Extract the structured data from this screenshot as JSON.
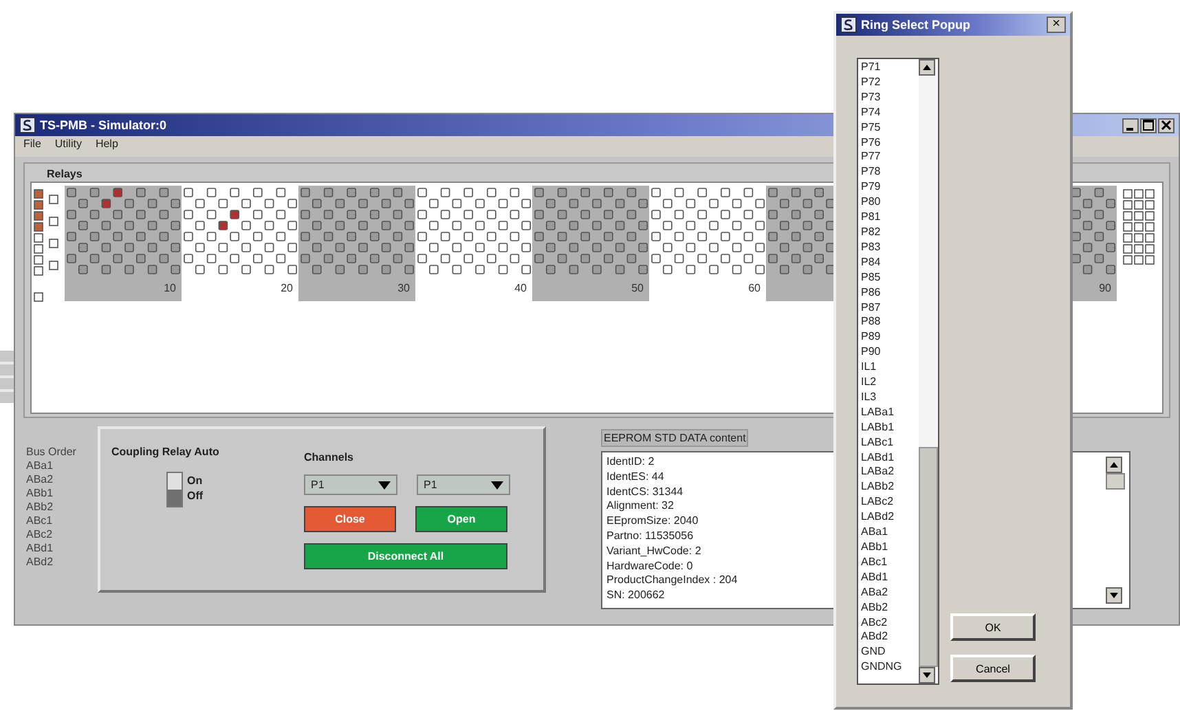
{
  "main_window": {
    "title": "TS-PMB - Simulator:0",
    "menu": [
      "File",
      "Utility",
      "Help"
    ]
  },
  "relays": {
    "title": "Relays",
    "indicators": [
      {
        "on": true
      },
      {
        "on": true
      },
      {
        "on": true
      },
      {
        "on": true
      },
      {
        "on": false
      },
      {
        "on": false
      },
      {
        "on": false
      },
      {
        "on": false
      }
    ],
    "left_blocks": [
      {
        "label": "10",
        "shaded": true,
        "rows": [
          [
            false,
            false,
            true,
            false,
            false
          ],
          [
            false,
            true,
            false,
            false,
            false
          ],
          [
            false,
            false,
            false,
            false,
            false
          ],
          [
            false,
            false,
            false,
            false,
            false
          ],
          [
            false,
            false,
            false,
            false,
            false
          ],
          [
            false,
            false,
            false,
            false,
            false
          ],
          [
            false,
            false,
            false,
            false,
            false
          ],
          [
            false,
            false,
            false,
            false,
            false
          ]
        ]
      },
      {
        "label": "20",
        "shaded": false,
        "rows": [
          [
            false,
            false,
            false,
            false,
            false
          ],
          [
            false,
            false,
            false,
            false,
            false
          ],
          [
            false,
            false,
            true,
            false,
            false
          ],
          [
            false,
            true,
            false,
            false,
            false
          ],
          [
            false,
            false,
            false,
            false,
            false
          ],
          [
            false,
            false,
            false,
            false,
            false
          ],
          [
            false,
            false,
            false,
            false,
            false
          ],
          [
            false,
            false,
            false,
            false,
            false
          ]
        ]
      },
      {
        "label": "30",
        "shaded": true,
        "rows": [
          [
            false,
            false,
            false,
            false,
            false
          ],
          [
            false,
            false,
            false,
            false,
            false
          ],
          [
            false,
            false,
            false,
            false,
            false
          ],
          [
            false,
            false,
            false,
            false,
            false
          ],
          [
            false,
            false,
            false,
            false,
            false
          ],
          [
            false,
            false,
            false,
            false,
            false
          ],
          [
            false,
            false,
            false,
            false,
            false
          ],
          [
            false,
            false,
            false,
            false,
            false
          ]
        ]
      },
      {
        "label": "40",
        "shaded": false,
        "rows": [
          [
            false,
            false,
            false,
            false,
            false
          ],
          [
            false,
            false,
            false,
            false,
            false
          ],
          [
            false,
            false,
            false,
            false,
            false
          ],
          [
            false,
            false,
            false,
            false,
            false
          ],
          [
            false,
            false,
            false,
            false,
            false
          ],
          [
            false,
            false,
            false,
            false,
            false
          ],
          [
            false,
            false,
            false,
            false,
            false
          ],
          [
            false,
            false,
            false,
            false,
            false
          ]
        ]
      },
      {
        "label": "50",
        "shaded": true,
        "rows": [
          [
            false,
            false,
            false,
            false,
            false
          ],
          [
            false,
            false,
            false,
            false,
            false
          ],
          [
            false,
            false,
            false,
            false,
            false
          ],
          [
            false,
            false,
            false,
            false,
            false
          ],
          [
            false,
            false,
            false,
            false,
            false
          ],
          [
            false,
            false,
            false,
            false,
            false
          ],
          [
            false,
            false,
            false,
            false,
            false
          ],
          [
            false,
            false,
            false,
            false,
            false
          ]
        ]
      },
      {
        "label": "60",
        "shaded": false,
        "rows": [
          [
            false,
            false,
            false,
            false,
            false
          ],
          [
            false,
            false,
            false,
            false,
            false
          ],
          [
            false,
            false,
            false,
            false,
            false
          ],
          [
            false,
            false,
            false,
            false,
            false
          ],
          [
            false,
            false,
            false,
            false,
            false
          ],
          [
            false,
            false,
            false,
            false,
            false
          ],
          [
            false,
            false,
            false,
            false,
            false
          ],
          [
            false,
            false,
            false,
            false,
            false
          ]
        ]
      },
      {
        "shaded": true
      }
    ],
    "right_blocks": [
      {
        "label": "90",
        "shaded": true
      }
    ]
  },
  "bus_order": [
    "Bus Order",
    "ABa1",
    "ABa2",
    "ABb1",
    "ABb2",
    "ABc1",
    "ABc2",
    "ABd1",
    "ABd2"
  ],
  "coupling": {
    "title": "Coupling Relay Auto",
    "switch_on": false,
    "on_label": "On",
    "off_label": "Off"
  },
  "channels": {
    "title": "Channels",
    "dropdowns": [
      "P1",
      "P1"
    ],
    "close": "Close",
    "open": "Open",
    "disconnect": "Disconnect All"
  },
  "eeprom": {
    "title": "EEPROM STD DATA content",
    "lines": [
      "IdentID: 2",
      "IdentES: 44",
      "IdentCS: 31344",
      "Alignment: 32",
      "EEpromSize: 2040",
      "Partno: 11535056",
      "Variant_HwCode: 2",
      "HardwareCode: 0",
      "ProductChangeIndex : 204",
      "SN: 200662"
    ]
  },
  "popup": {
    "title": "Ring Select Popup",
    "close": "×",
    "items": [
      "P71",
      "P72",
      "P73",
      "P74",
      "P75",
      "P76",
      "P77",
      "P78",
      "P79",
      "P80",
      "P81",
      "P82",
      "P83",
      "P84",
      "P85",
      "P86",
      "P87",
      "P88",
      "P89",
      "P90",
      "IL1",
      "IL2",
      "IL3",
      "LABa1",
      "LABb1",
      "LABc1",
      "LABd1",
      "LABa2",
      "LABb2",
      "LABc2",
      "LABd2",
      "ABa1",
      "ABb1",
      "ABc1",
      "ABd1",
      "ABa2",
      "ABb2",
      "ABc2",
      "ABd2",
      "GND",
      "GNDNG"
    ],
    "ok": "OK",
    "cancel": "Cancel"
  }
}
